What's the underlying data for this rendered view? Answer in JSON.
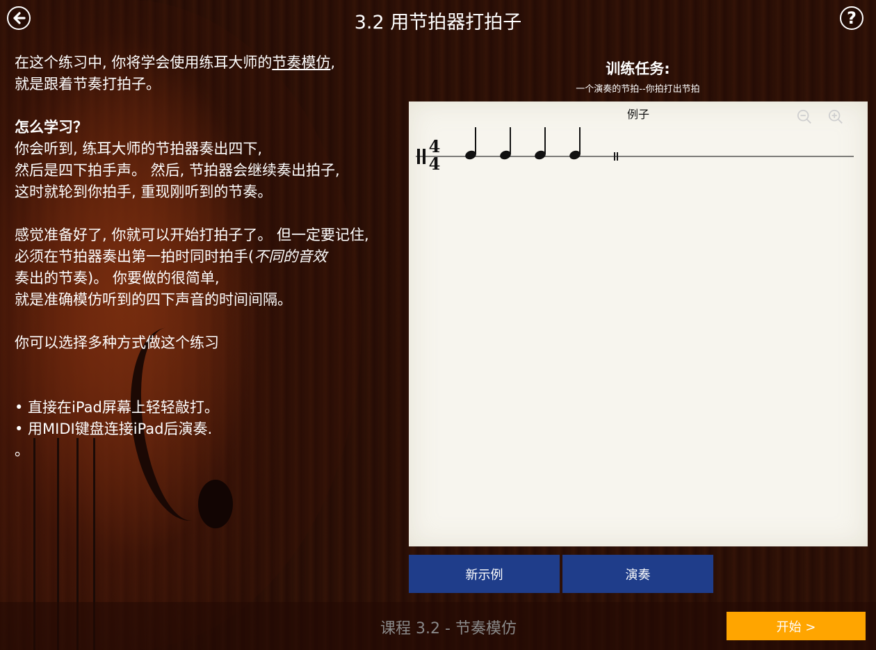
{
  "header": {
    "title": "3.2 用节拍器打拍子",
    "help_glyph": "?"
  },
  "intro": {
    "line1_pre": "在这个练习中, 你将学会使用练耳大师的",
    "line1_link": "节奏模仿",
    "line1_post": ",",
    "line2": "就是跟着节奏打拍子。",
    "how_title": "怎么学习？",
    "how_lines": [
      "你会听到, 练耳大师的节拍器奏出四下,",
      "然后是四下拍手声。 然后, 节拍器会继续奏出拍子,",
      "这时就轮到你拍手, 重现刚听到的节奏。"
    ],
    "ready_line1": "感觉准备好了, 你就可以开始打拍子了。 但一定要记住,",
    "ready_line2_pre": "必须在节拍器奏出第一拍时同时拍手(",
    "ready_line2_italic": "不同的音效",
    "ready_line3": "奏出的节奏)。 你要做的很简单,",
    "ready_line4": "就是准确模仿听到的四下声音的时间间隔。",
    "methods_title": "你可以选择多种方式做这个练习",
    "bullets": [
      "• 直接在iPad屏幕上轻轻敲打。",
      "• 用MIDI键盘连接iPad后演奏."
    ],
    "trailing": "。"
  },
  "task": {
    "title": "训练任务:",
    "subtitle": "一个演奏的节拍--你拍打出节拍"
  },
  "score": {
    "label": "例子",
    "time_signature_top": "4",
    "time_signature_bottom": "4",
    "note_count": 4
  },
  "buttons": {
    "new_example": "新示例",
    "play": "演奏",
    "start": "开始 >"
  },
  "footer": {
    "lesson": "课程 3.2 - 节奏模仿"
  }
}
